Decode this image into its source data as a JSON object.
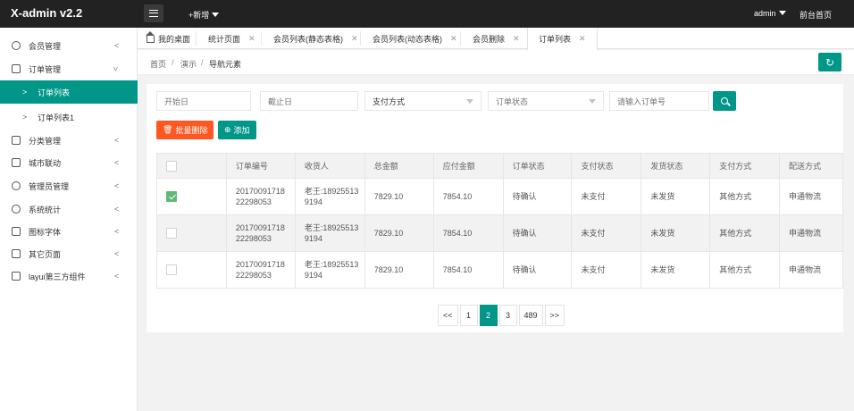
{
  "header": {
    "logo": "X-admin v2.2",
    "add_label": "+新增",
    "user": "admin",
    "front_link": "前台首页"
  },
  "sidebar": {
    "items": [
      {
        "label": "会员管理",
        "icon": "user-icon"
      },
      {
        "label": "订单管理",
        "icon": "order-icon",
        "expanded": true
      },
      {
        "label": "订单列表",
        "sub": true,
        "active": true
      },
      {
        "label": "订单列表1",
        "sub": true
      },
      {
        "label": "分类管理",
        "icon": "category-icon"
      },
      {
        "label": "城市联动",
        "icon": "city-icon"
      },
      {
        "label": "管理员管理",
        "icon": "admin-icon"
      },
      {
        "label": "系统统计",
        "icon": "stats-icon"
      },
      {
        "label": "图标字体",
        "icon": "font-icon"
      },
      {
        "label": "其它页面",
        "icon": "pages-icon"
      },
      {
        "label": "layui第三方组件",
        "icon": "components-icon"
      }
    ]
  },
  "tabs": [
    {
      "label": "我的桌面",
      "home": true
    },
    {
      "label": "统计页面"
    },
    {
      "label": "会员列表(静态表格)"
    },
    {
      "label": "会员列表(动态表格)"
    },
    {
      "label": "会员删除"
    },
    {
      "label": "订单列表",
      "active": true
    }
  ],
  "breadcrumb": [
    "首页",
    "演示",
    "导航元素"
  ],
  "search": {
    "start_placeholder": "开始日",
    "end_placeholder": "截止日",
    "pay_method_selected": "支付方式",
    "order_status_placeholder": "订单状态",
    "order_no_placeholder": "请输入订单号"
  },
  "actions": {
    "batch_delete": "批量删除",
    "add": "添加"
  },
  "table": {
    "columns": [
      "订单编号",
      "收货人",
      "总金额",
      "应付金额",
      "订单状态",
      "支付状态",
      "发货状态",
      "支付方式",
      "配送方式"
    ],
    "rows": [
      {
        "checked": true,
        "order_no_1": "20170091718",
        "order_no_2": "22298053",
        "consignee_1": "老王:18925513",
        "consignee_2": "9194",
        "total": "7829.10",
        "payable": "7854.10",
        "order_status": "待确认",
        "pay_status": "未支付",
        "ship_status": "未发货",
        "pay_method": "其他方式",
        "delivery": "申通物流"
      },
      {
        "checked": false,
        "order_no_1": "20170091718",
        "order_no_2": "22298053",
        "consignee_1": "老王:18925513",
        "consignee_2": "9194",
        "total": "7829.10",
        "payable": "7854.10",
        "order_status": "待确认",
        "pay_status": "未支付",
        "ship_status": "未发货",
        "pay_method": "其他方式",
        "delivery": "申通物流"
      },
      {
        "checked": false,
        "order_no_1": "20170091718",
        "order_no_2": "22298053",
        "consignee_1": "老王:18925513",
        "consignee_2": "9194",
        "total": "7829.10",
        "payable": "7854.10",
        "order_status": "待确认",
        "pay_status": "未支付",
        "ship_status": "未发货",
        "pay_method": "其他方式",
        "delivery": "申通物流"
      }
    ]
  },
  "pagination": {
    "prev": "<<",
    "pages": [
      "1",
      "2",
      "3",
      "489"
    ],
    "current": "2",
    "next": ">>"
  },
  "colors": {
    "primary": "#009688",
    "danger": "#ff5722",
    "header_bg": "#222222",
    "check": "#5fb878"
  }
}
